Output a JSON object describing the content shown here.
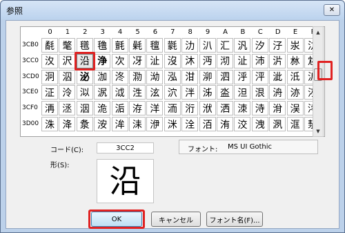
{
  "window": {
    "title": "参照",
    "close_glyph": "✕"
  },
  "grid": {
    "columns": [
      "0",
      "1",
      "2",
      "3",
      "4",
      "5",
      "6",
      "7",
      "8",
      "9",
      "A",
      "B",
      "C",
      "D",
      "E",
      "F"
    ],
    "rows": [
      {
        "code": "3CB0",
        "chars": [
          "氄",
          "氅",
          "氆",
          "氇",
          "氈",
          "氉",
          "氊",
          "氋",
          "氻",
          "汃",
          "汇",
          "汎",
          "汐",
          "汓",
          "汖",
          "汸"
        ]
      },
      {
        "code": "3CC0",
        "chars": [
          "汷",
          "沢",
          "沿",
          "浄",
          "次",
          "冴",
          "沚",
          "沒",
          "沐",
          "沔",
          "沏",
          "沚",
          "沛",
          "沜",
          "沝",
          "沊"
        ]
      },
      {
        "code": "3CD0",
        "chars": [
          "泂",
          "泅",
          "泌",
          "泇",
          "泈",
          "泐",
          "泑",
          "泓",
          "泔",
          "泖",
          "泗",
          "泘",
          "泙",
          "泚",
          "泜",
          "泝"
        ]
      },
      {
        "code": "3CE0",
        "chars": [
          "泟",
          "泠",
          "泤",
          "泦",
          "泧",
          "泩",
          "泫",
          "泬",
          "泮",
          "泲",
          "泴",
          "泹",
          "泿",
          "洀",
          "洂",
          "洃"
        ]
      },
      {
        "code": "3CF0",
        "chars": [
          "洅",
          "洆",
          "洇",
          "洈",
          "洉",
          "洊",
          "洋",
          "洏",
          "洐",
          "洑",
          "洒",
          "洓",
          "洔",
          "洕",
          "洖",
          "洘"
        ]
      },
      {
        "code": "3D00",
        "chars": [
          "洙",
          "洚",
          "洜",
          "洝",
          "洠",
          "洡",
          "洢",
          "洣",
          "洤",
          "洦",
          "洧",
          "洨",
          "洩",
          "洬",
          "洭",
          "洯"
        ]
      }
    ],
    "selected_row": 1,
    "selected_col": 2,
    "bold_row": 1,
    "bold_col": 3,
    "bold_row2": 2,
    "bold_col2": 2
  },
  "scroll": {
    "up_glyph": "▲",
    "down_glyph": "▼"
  },
  "info": {
    "code_label": "コード(C):",
    "code_value": "3CC2",
    "font_label": "フォント:",
    "font_name": "MS UI Gothic",
    "shape_label": "形(S):",
    "preview_char": "沿"
  },
  "buttons": {
    "ok": "OK",
    "cancel": "キャンセル",
    "font_name": "フォント名(F)..."
  },
  "colors": {
    "highlight": "#e02222"
  }
}
